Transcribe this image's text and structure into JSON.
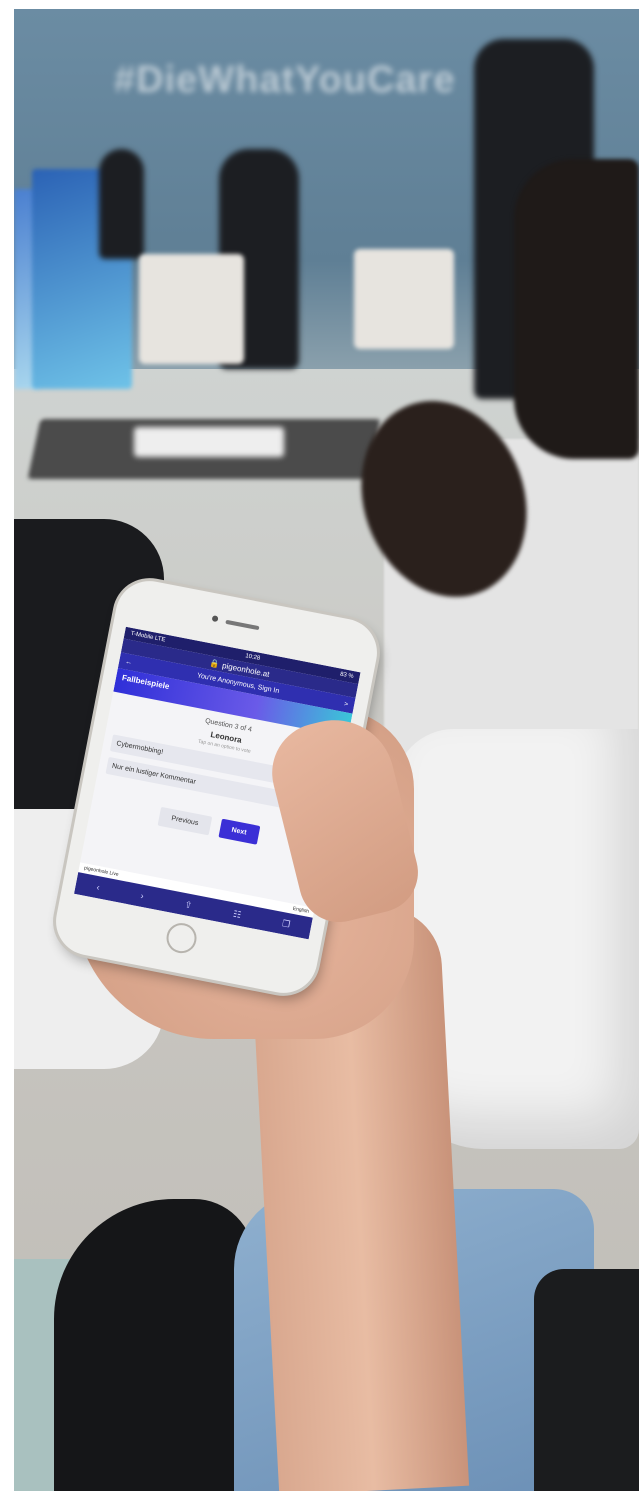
{
  "scene": {
    "wall_text": "#DieWhatYouCare"
  },
  "phone": {
    "status": {
      "carrier": "T-Mobile LTE",
      "time": "10:28",
      "battery": "83 %"
    },
    "url": "pigeonhole.at",
    "nav": {
      "back": "←",
      "user": "You're Anonymous, Sign In",
      "forward": ">"
    },
    "event_title": "Fallbeispiele",
    "question_count": "Question 3 of 4",
    "question_title": "Leonora",
    "question_hint": "Tap on an option to vote",
    "options": [
      "Cybermobbing!",
      "Nur ein lustiger Kommentar"
    ],
    "buttons": {
      "previous": "Previous",
      "next": "Next"
    },
    "footer": {
      "brand": "pigeonhole Live",
      "language": "English"
    },
    "toolbar_icons": [
      "back-icon",
      "forward-icon",
      "share-icon",
      "bookmarks-icon",
      "tabs-icon"
    ]
  }
}
